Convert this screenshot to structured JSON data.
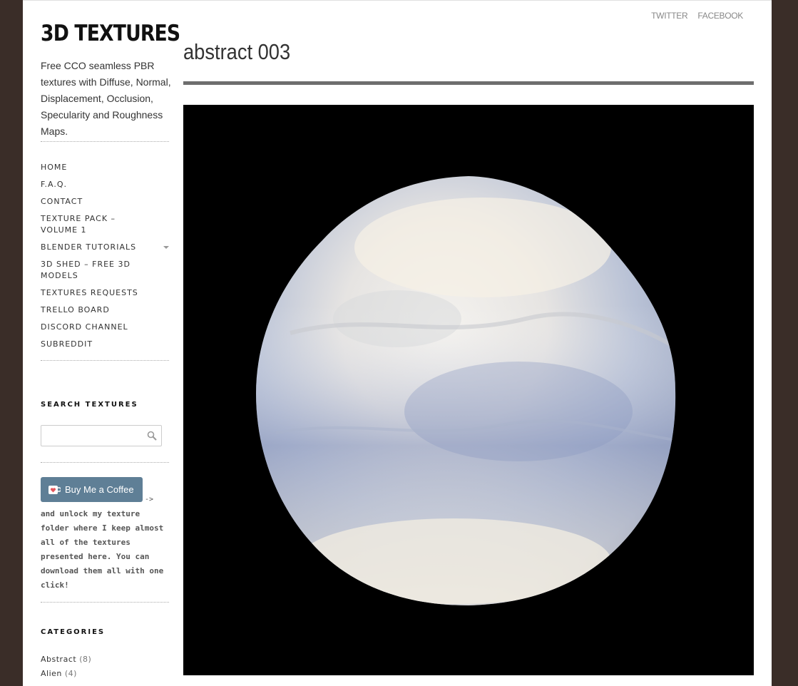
{
  "site": {
    "title": "3D TEXTURES",
    "description": "Free CCO seamless PBR textures with Diffuse, Normal, Displacement, Occlusion, Specularity and Roughness Maps."
  },
  "topnav": [
    "TWITTER",
    "FACEBOOK"
  ],
  "nav": [
    {
      "label": "HOME"
    },
    {
      "label": "F.A.Q."
    },
    {
      "label": "CONTACT"
    },
    {
      "label": "TEXTURE PACK – VOLUME 1"
    },
    {
      "label": "BLENDER TUTORIALS",
      "has_submenu": true
    },
    {
      "label": "3D SHED – FREE 3D MODELS"
    },
    {
      "label": "TEXTURES REQUESTS"
    },
    {
      "label": "TRELLO BOARD"
    },
    {
      "label": "DISCORD CHANNEL"
    },
    {
      "label": "SUBREDDIT"
    }
  ],
  "search": {
    "title": "SEARCH TEXTURES",
    "placeholder": "",
    "icon": "search-icon"
  },
  "coffee": {
    "button_label": "Buy Me a Coffee",
    "arrow": "->",
    "text": "and unlock my texture folder where I keep almost all of the textures presented here. You can download them all with one click!",
    "button_color": "#5f7f96",
    "icon": "coffee-cup-heart-icon"
  },
  "categories": {
    "title": "CATEGORIES",
    "items": [
      {
        "name": "Abstract",
        "count": "(8)"
      },
      {
        "name": "Alien",
        "count": "(4)"
      }
    ]
  },
  "post": {
    "title": "abstract 003"
  },
  "colors": {
    "background": "#3a2d28",
    "page": "#ffffff",
    "title_rule": "#6e6e6e",
    "hero_background": "#000000"
  }
}
